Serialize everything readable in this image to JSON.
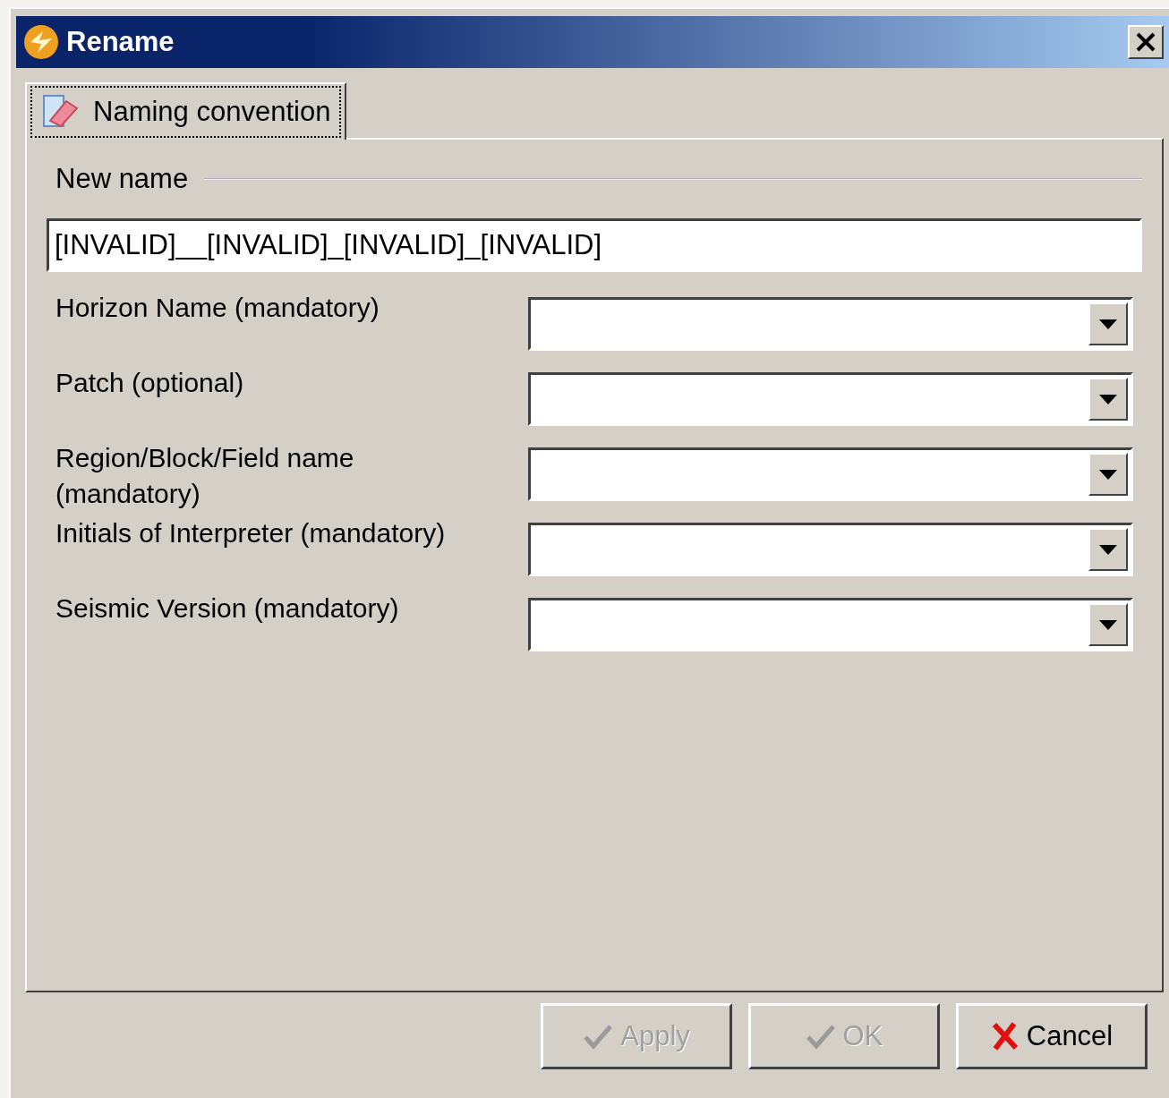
{
  "window": {
    "title": "Rename"
  },
  "tabs": [
    {
      "label": "Naming convention",
      "selected": true
    }
  ],
  "section_label": "New name",
  "new_name": {
    "value": "[INVALID]__[INVALID]_[INVALID]_[INVALID]"
  },
  "fields": [
    {
      "label": "Horizon Name (mandatory)"
    },
    {
      "label": "Patch (optional)"
    },
    {
      "label": "Region/Block/Field name (mandatory)"
    },
    {
      "label": "Initials of Interpreter (mandatory)"
    },
    {
      "label": "Seismic Version (mandatory)"
    }
  ],
  "buttons": [
    {
      "label": "Apply",
      "kind": "check",
      "disabled": true
    },
    {
      "label": "OK",
      "kind": "check",
      "disabled": true
    },
    {
      "label": "Cancel",
      "kind": "cross",
      "disabled": false
    }
  ]
}
